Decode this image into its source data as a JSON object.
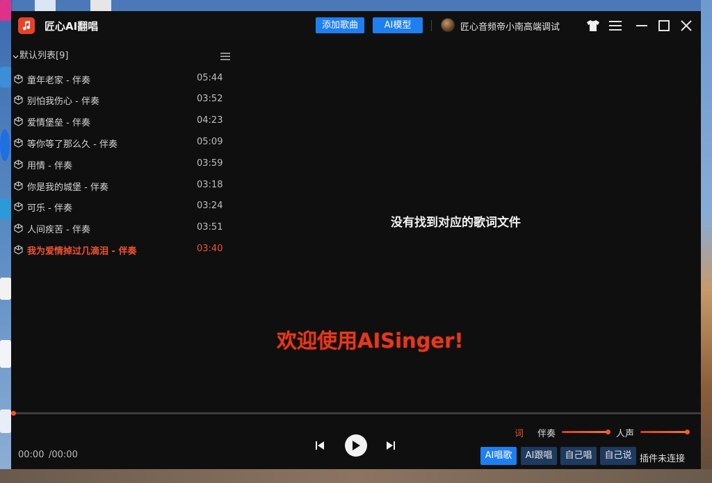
{
  "app": {
    "title": "匠心AI翻唱",
    "add_song_label": "添加歌曲",
    "ai_model_label": "AI模型",
    "user_name": "匠心音频帝小南高端调试"
  },
  "playlist": {
    "title": "默认列表[9]",
    "songs": [
      {
        "name": "童年老家 - 伴奏",
        "duration": "05:44"
      },
      {
        "name": "别怕我伤心 - 伴奏",
        "duration": "03:52"
      },
      {
        "name": "爱情堡垒 - 伴奏",
        "duration": "04:23"
      },
      {
        "name": "等你等了那么久 - 伴奏",
        "duration": "05:09"
      },
      {
        "name": "用情 - 伴奏",
        "duration": "03:59"
      },
      {
        "name": "你是我的城堡 - 伴奏",
        "duration": "03:18"
      },
      {
        "name": "可乐 - 伴奏",
        "duration": "03:24"
      },
      {
        "name": "人间疾苦 - 伴奏",
        "duration": "03:51"
      },
      {
        "name": "我为爱情掉过几滴泪 - 伴奏",
        "duration": "03:40"
      }
    ],
    "active_index": 8
  },
  "main": {
    "lyrics_message": "没有找到对应的歌词文件",
    "welcome_text": "欢迎使用AISinger!"
  },
  "player": {
    "current_time": "00:00",
    "total_time": "/00:00",
    "progress": 0,
    "lyric_toggle": "词",
    "accompaniment_label": "伴奏",
    "accompaniment_level": 1.0,
    "vocal_label": "人声",
    "vocal_level": 1.0,
    "modes": [
      "AI唱歌",
      "AI跟唱",
      "自己唱",
      "自己说"
    ],
    "active_mode": 0,
    "plugin_status": "插件未连接"
  },
  "colors": {
    "accent": "#1e7ff0",
    "highlight": "#f0522e",
    "window_bg": "#0f0f10"
  },
  "icons": [
    "app-logo-icon",
    "shirt-icon",
    "menu-icon",
    "minimize-icon",
    "maximize-icon",
    "close-icon",
    "chevron-down-icon",
    "list-menu-icon",
    "song-icon",
    "prev-icon",
    "play-icon",
    "next-icon"
  ]
}
